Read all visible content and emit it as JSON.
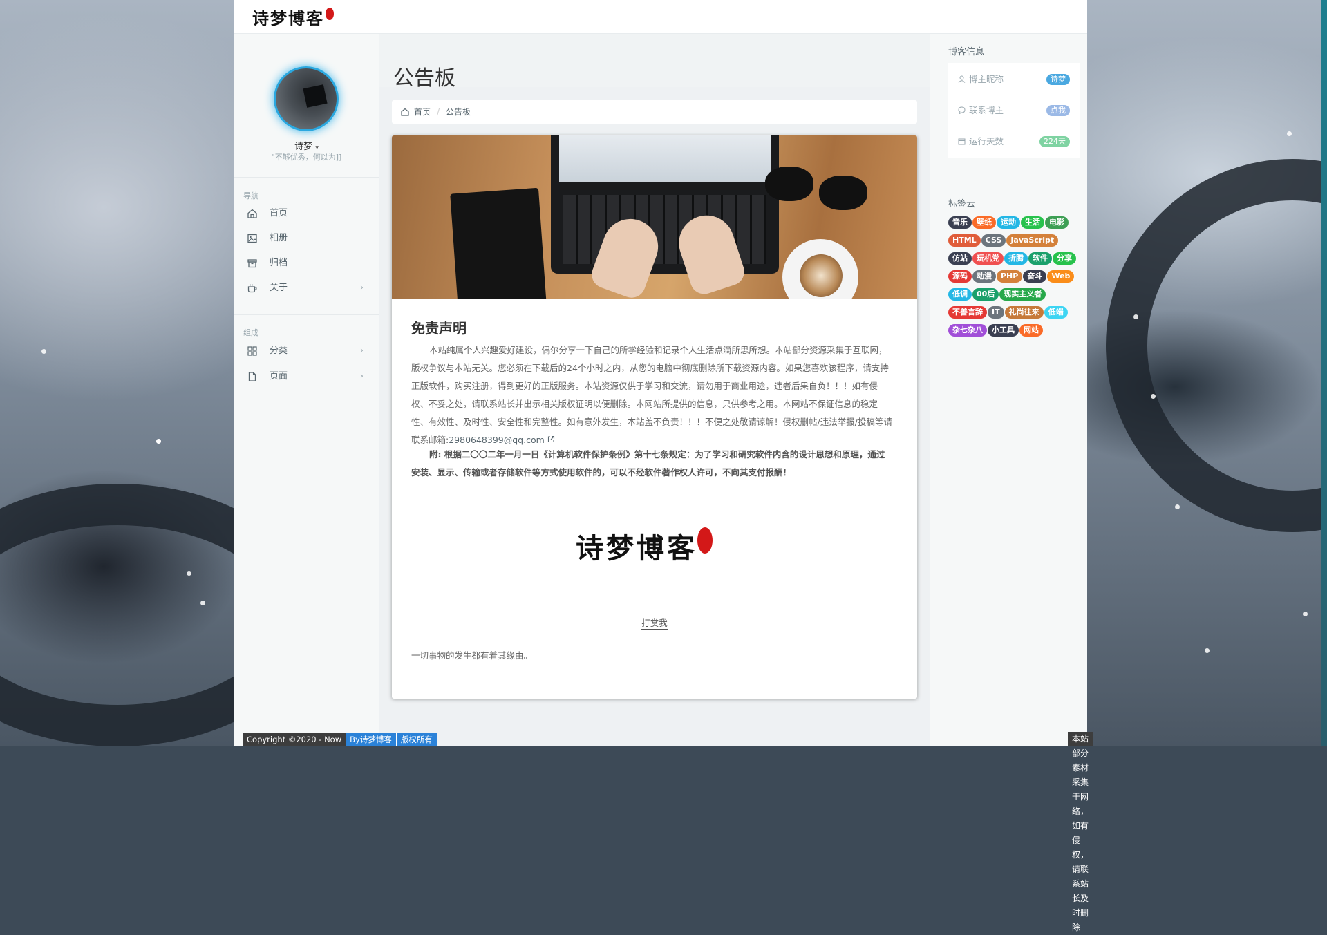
{
  "app": {
    "logo_text": "诗梦博客"
  },
  "sidebar": {
    "username": "诗梦",
    "motto": "\"不够优秀，何以为]]",
    "nav_heading": "导航",
    "nav_items": [
      {
        "label": "首页",
        "icon": "home-icon"
      },
      {
        "label": "相册",
        "icon": "image-icon"
      },
      {
        "label": "归档",
        "icon": "archive-icon"
      },
      {
        "label": "关于",
        "icon": "coffee-icon",
        "chevron": "›"
      }
    ],
    "group_heading": "组成",
    "group_items": [
      {
        "label": "分类",
        "icon": "grid-icon",
        "chevron": "›"
      },
      {
        "label": "页面",
        "icon": "file-icon",
        "chevron": "›"
      }
    ]
  },
  "main": {
    "page_title": "公告板",
    "breadcrumb": {
      "home": "首页",
      "separator": "/",
      "current": "公告板"
    },
    "post": {
      "title": "免责声明",
      "paragraph1": "本站纯属个人兴趣爱好建设，偶尔分享一下自己的所学经验和记录个人生活点滴所思所想。本站部分资源采集于互联网，版权争议与本站无关。您必须在下载后的24个小时之内，从您的电脑中彻底删除所下载资源内容。如果您喜欢该程序，请支持正版软件，购买注册，得到更好的正版服务。本站资源仅供于学习和交流，请勿用于商业用途，违者后果自负！！！如有侵权、不妥之处，请联系站长并出示相关版权证明以便删除。本网站所提供的信息，只供参考之用。本网站不保证信息的稳定性、有效性、及时性、安全性和完整性。如有意外发生，本站盖不负责！！！不便之处敬请谅解！侵权删帖/违法举报/投稿等请联系邮箱:",
      "email": "2980648399@qq.com",
      "paragraph2": "附: 根据二〇〇二年一月一日《计算机软件保护条例》第十七条规定：为了学习和研究软件内含的设计思想和原理，通过安装、显示、传输或者存储软件等方式使用软件的，可以不经软件著作权人许可，不向其支付报酬！",
      "signature": "诗梦博客",
      "reward": "打赏我",
      "ending": "一切事物的发生都有着其缘由。"
    }
  },
  "footer": {
    "copyright": "Copyright ©2020 - Now",
    "by": "By诗梦博客",
    "rights": "版权所有",
    "notice": "本站部分素材采集于网络，如有侵权，请联系站长及时删除"
  },
  "right": {
    "info_heading": "博客信息",
    "info_rows": [
      {
        "label": "博主昵称",
        "badge": "诗梦",
        "badge_color": "#4aa8e0",
        "icon": "user-icon"
      },
      {
        "label": "联系博主",
        "badge": "点我",
        "badge_color": "#9bb9e6",
        "icon": "chat-icon"
      },
      {
        "label": "运行天数",
        "badge": "224天",
        "badge_color": "#7fd3a2",
        "icon": "calendar-icon"
      }
    ],
    "tags_heading": "标签云",
    "tags": [
      {
        "label": "音乐",
        "color": "#3a3f51"
      },
      {
        "label": "壁纸",
        "color": "#fa6b28"
      },
      {
        "label": "运动",
        "color": "#23b7e5"
      },
      {
        "label": "生活",
        "color": "#27c24c"
      },
      {
        "label": "电影",
        "color": "#3d9f54"
      },
      {
        "label": "HTML",
        "color": "#e05d3a"
      },
      {
        "label": "CSS",
        "color": "#6c757d"
      },
      {
        "label": "JavaScript",
        "color": "#d4813b"
      },
      {
        "label": "仿站",
        "color": "#3a3f51"
      },
      {
        "label": "玩机党",
        "color": "#f05050"
      },
      {
        "label": "折腾",
        "color": "#23b7e5"
      },
      {
        "label": "软件",
        "color": "#1aa06b"
      },
      {
        "label": "分享",
        "color": "#27c24c"
      },
      {
        "label": "源码",
        "color": "#e53935"
      },
      {
        "label": "动漫",
        "color": "#6c757d"
      },
      {
        "label": "PHP",
        "color": "#d4813b"
      },
      {
        "label": "奋斗",
        "color": "#3a3f51"
      },
      {
        "label": "Web",
        "color": "#fa8d1a"
      },
      {
        "label": "低调",
        "color": "#23b7e5"
      },
      {
        "label": "00后",
        "color": "#1aa06b"
      },
      {
        "label": "现实主义者",
        "color": "#27a84a"
      },
      {
        "label": "不善言辞",
        "color": "#e53935"
      },
      {
        "label": "IT",
        "color": "#6c757d"
      },
      {
        "label": "礼尚往来",
        "color": "#c77a3a"
      },
      {
        "label": "低端",
        "color": "#3dd5f3"
      },
      {
        "label": "杂七杂八",
        "color": "#a14fd8"
      },
      {
        "label": "小工具",
        "color": "#3a3f51"
      },
      {
        "label": "网站",
        "color": "#fa6b28"
      }
    ]
  }
}
